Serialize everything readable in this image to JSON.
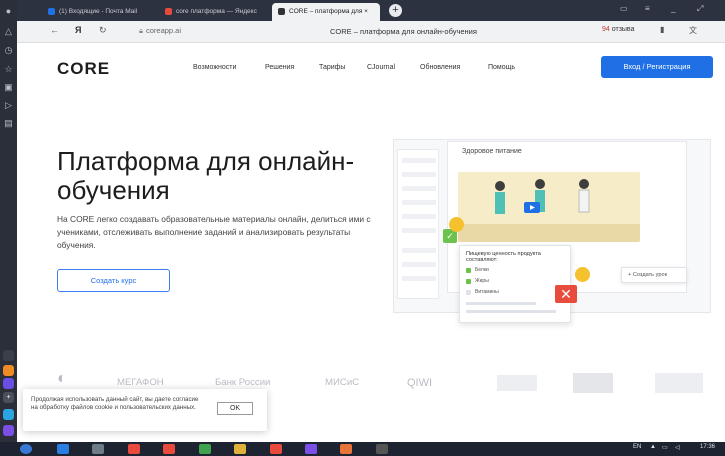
{
  "browser": {
    "tabs": [
      {
        "title": "(1) Входящие - Почта Mail",
        "favicon_color": "#1f6fe5",
        "active": false
      },
      {
        "title": "core платформа — Яндекс",
        "favicon_color": "#e84b3c",
        "active": false
      },
      {
        "title": "CORE – платформа для",
        "favicon_color": "#333333",
        "active": true
      }
    ],
    "url": "coreapp.ai",
    "page_title": "CORE – платформа для онлайн-обучения",
    "reviews_count": "94",
    "reviews_label": "отзыва"
  },
  "site": {
    "logo": "CORE",
    "nav": [
      "Возможности",
      "Решения",
      "Тарифы",
      "CJournal",
      "Обновления",
      "Помощь"
    ],
    "login_button": "Вход / Регистрация",
    "hero_title": "Платформа для онлайн-обучения",
    "hero_text": "На CORE легко создавать образовательные материалы онлайн, делиться ими с учениками, отслеживать выполнение заданий и анализировать результаты обучения.",
    "create_button": "Создать курс",
    "illustration": {
      "doc_title": "Здоровое питание",
      "quiz_question": "Пищевую ценность продукта составляют:",
      "quiz_options": [
        "Белки",
        "Жиры",
        "Витамины"
      ],
      "add_block": "+ Создать урок"
    },
    "partners": [
      "МЕГАФОН",
      "Банк России",
      "МИСиС",
      "QIWI"
    ],
    "cookie": {
      "text": "Продолжая использовать данный сайт, вы даете согласие на обработку файлов cookie и пользовательских данных.",
      "ok": "OK"
    }
  },
  "taskbar": {
    "lang": "EN",
    "time": "17:36"
  },
  "colors": {
    "accent": "#1f6fe5",
    "success": "#6cc24a",
    "error": "#e74c3c"
  }
}
